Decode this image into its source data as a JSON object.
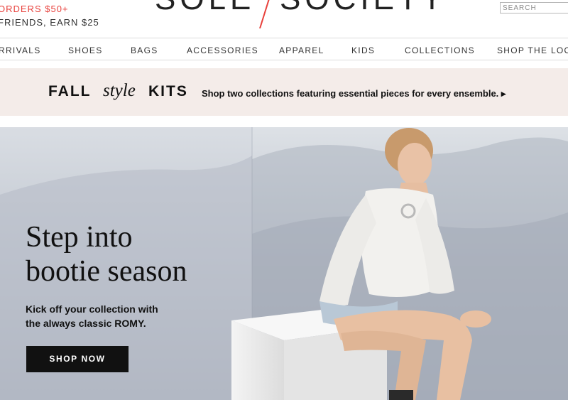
{
  "header": {
    "promo_line1": "ORDERS $50+",
    "promo_line2": "FRIENDS, EARN $25",
    "logo_left": "SOLE",
    "logo_right": "SOCIETY",
    "search_placeholder": "SEARCH",
    "accent_color": "#e8413c"
  },
  "nav": {
    "items": [
      "RRIVALS",
      "SHOES",
      "BAGS",
      "ACCESSORIES",
      "APPAREL",
      "KIDS",
      "COLLECTIONS",
      "SHOP THE LOOK"
    ]
  },
  "banner": {
    "word_fall": "FALL",
    "word_style": "style",
    "word_kits": "KITS",
    "description": "Shop two collections featuring essential pieces for every ensemble. ▸",
    "background": "#f4ece9"
  },
  "hero": {
    "title_line1": "Step into",
    "title_line2": "bootie season",
    "subtitle_line1": "Kick off your collection with",
    "subtitle_line2": "the always classic ROMY.",
    "cta": "SHOP NOW"
  }
}
